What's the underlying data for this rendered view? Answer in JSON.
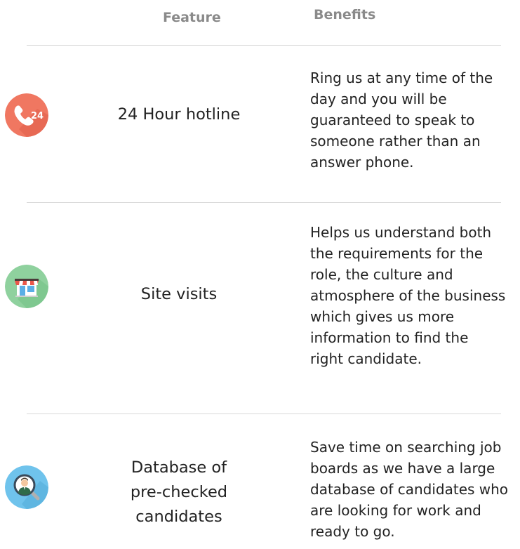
{
  "header": {
    "feature_label": "Feature",
    "benefits_label": "Benefits"
  },
  "rows": [
    {
      "icon": "phone-24-icon",
      "icon_color": "#f07761",
      "icon_text": "24",
      "feature_lines": [
        "24 Hour hotline"
      ],
      "benefit_lines": [
        "Ring us at any time of the",
        "day and you will be",
        "guaranteed to speak to",
        "someone rather than an",
        "answer phone."
      ]
    },
    {
      "icon": "shop-icon",
      "icon_color": "#8fd19e",
      "feature_lines": [
        "Site visits"
      ],
      "benefit_lines": [
        "Helps us understand both",
        "the requirements for the",
        "role, the culture and",
        "atmosphere of the business",
        "which gives us more",
        "information to find the",
        "right candidate."
      ]
    },
    {
      "icon": "candidate-search-icon",
      "icon_color": "#6fc3ec",
      "feature_lines": [
        "Database of",
        "pre-checked",
        "candidates"
      ],
      "benefit_lines": [
        "Save time on searching job",
        "boards as we have a large",
        "database of candidates who",
        "are looking for work and",
        "ready to go."
      ]
    }
  ]
}
